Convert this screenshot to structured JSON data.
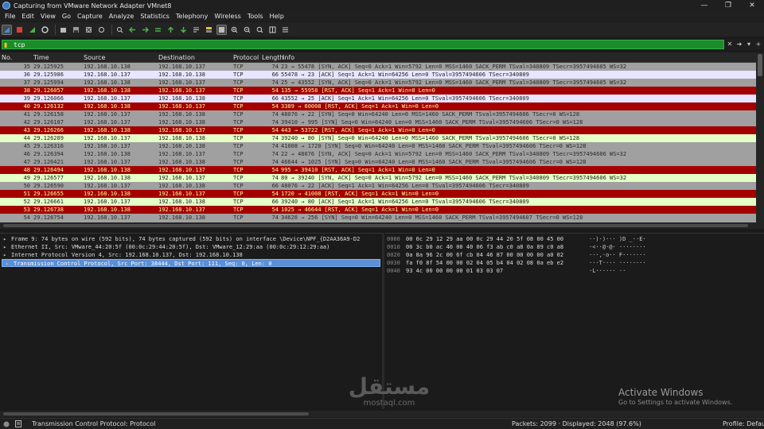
{
  "window": {
    "title": "Capturing from VMware Network Adapter VMnet8",
    "controls": [
      "—",
      "❐",
      "✕"
    ]
  },
  "menu": [
    "File",
    "Edit",
    "View",
    "Go",
    "Capture",
    "Analyze",
    "Statistics",
    "Telephony",
    "Wireless",
    "Tools",
    "Help"
  ],
  "filter": {
    "value": "tcp"
  },
  "columns": [
    "No.",
    "Time",
    "Source",
    "Destination",
    "Protocol",
    "Length",
    "Info"
  ],
  "packets": [
    {
      "no": "35",
      "time": "29.125925",
      "src": "192.168.10.138",
      "dst": "192.168.10.137",
      "proto": "TCP",
      "len": "74",
      "info": "23 → 55478 [SYN, ACK] Seq=0 Ack=1 Win=5792 Len=0 MSS=1460 SACK_PERM TSval=340809 TSecr=3957494605 WS=32",
      "bg": "#a0a0a0",
      "fg": "#2a2a2a"
    },
    {
      "no": "36",
      "time": "29.125986",
      "src": "192.168.10.137",
      "dst": "192.168.10.138",
      "proto": "TCP",
      "len": "66",
      "info": "55478 → 23 [ACK] Seq=1 Ack=1 Win=64256 Len=0 TSval=3957494606 TSecr=340809",
      "bg": "#e7e6ff",
      "fg": "#222222"
    },
    {
      "no": "37",
      "time": "29.125994",
      "src": "192.168.10.138",
      "dst": "192.168.10.137",
      "proto": "TCP",
      "len": "74",
      "info": "25 → 43552 [SYN, ACK] Seq=0 Ack=1 Win=5792 Len=0 MSS=1460 SACK_PERM TSval=340809 TSecr=3957494605 WS=32",
      "bg": "#a0a0a0",
      "fg": "#2a2a2a"
    },
    {
      "no": "38",
      "time": "29.126057",
      "src": "192.168.10.138",
      "dst": "192.168.10.137",
      "proto": "TCP",
      "len": "54",
      "info": "135 → 55958 [RST, ACK] Seq=1 Ack=1 Win=0 Len=0",
      "bg": "#a40000",
      "fg": "#fffc9c"
    },
    {
      "no": "39",
      "time": "29.126066",
      "src": "192.168.10.137",
      "dst": "192.168.10.138",
      "proto": "TCP",
      "len": "66",
      "info": "43552 → 25 [ACK] Seq=1 Ack=1 Win=64256 Len=0 TSval=3957494606 TSecr=340809",
      "bg": "#e7e6ff",
      "fg": "#222222"
    },
    {
      "no": "40",
      "time": "29.126132",
      "src": "192.168.10.138",
      "dst": "192.168.10.137",
      "proto": "TCP",
      "len": "54",
      "info": "3389 → 60008 [RST, ACK] Seq=1 Ack=1 Win=0 Len=0",
      "bg": "#a40000",
      "fg": "#fffc9c"
    },
    {
      "no": "41",
      "time": "29.126158",
      "src": "192.168.10.137",
      "dst": "192.168.10.138",
      "proto": "TCP",
      "len": "74",
      "info": "48076 → 22 [SYN] Seq=0 Win=64240 Len=0 MSS=1460 SACK_PERM TSval=3957494606 TSecr=0 WS=128",
      "bg": "#a0a0a0",
      "fg": "#2a2a2a"
    },
    {
      "no": "42",
      "time": "29.126187",
      "src": "192.168.10.137",
      "dst": "192.168.10.138",
      "proto": "TCP",
      "len": "74",
      "info": "39410 → 995 [SYN] Seq=0 Win=64240 Len=0 MSS=1460 SACK_PERM TSval=3957494606 TSecr=0 WS=128",
      "bg": "#a0a0a0",
      "fg": "#2a2a2a"
    },
    {
      "no": "43",
      "time": "29.126266",
      "src": "192.168.10.138",
      "dst": "192.168.10.137",
      "proto": "TCP",
      "len": "54",
      "info": "443 → 53722 [RST, ACK] Seq=1 Ack=1 Win=0 Len=0",
      "bg": "#a40000",
      "fg": "#fffc9c"
    },
    {
      "no": "44",
      "time": "29.126289",
      "src": "192.168.10.137",
      "dst": "192.168.10.138",
      "proto": "TCP",
      "len": "74",
      "info": "39240 → 80 [SYN] Seq=0 Win=64240 Len=0 MSS=1460 SACK_PERM TSval=3957494606 TSecr=0 WS=128",
      "bg": "#e4ffc7",
      "fg": "#222222"
    },
    {
      "no": "45",
      "time": "29.126316",
      "src": "192.168.10.137",
      "dst": "192.168.10.138",
      "proto": "TCP",
      "len": "74",
      "info": "41008 → 1720 [SYN] Seq=0 Win=64240 Len=0 MSS=1460 SACK_PERM TSval=3957494606 TSecr=0 WS=128",
      "bg": "#a0a0a0",
      "fg": "#2a2a2a"
    },
    {
      "no": "46",
      "time": "29.126394",
      "src": "192.168.10.138",
      "dst": "192.168.10.137",
      "proto": "TCP",
      "len": "74",
      "info": "22 → 48076 [SYN, ACK] Seq=0 Ack=1 Win=5792 Len=0 MSS=1460 SACK_PERM TSval=340809 TSecr=3957494606 WS=32",
      "bg": "#a0a0a0",
      "fg": "#2a2a2a"
    },
    {
      "no": "47",
      "time": "29.126421",
      "src": "192.168.10.137",
      "dst": "192.168.10.138",
      "proto": "TCP",
      "len": "74",
      "info": "46644 → 1025 [SYN] Seq=0 Win=64240 Len=0 MSS=1460 SACK_PERM TSval=3957494606 TSecr=0 WS=128",
      "bg": "#a0a0a0",
      "fg": "#2a2a2a"
    },
    {
      "no": "48",
      "time": "29.126494",
      "src": "192.168.10.138",
      "dst": "192.168.10.137",
      "proto": "TCP",
      "len": "54",
      "info": "995 → 39410 [RST, ACK] Seq=1 Ack=1 Win=0 Len=0",
      "bg": "#a40000",
      "fg": "#fffc9c"
    },
    {
      "no": "49",
      "time": "29.126577",
      "src": "192.168.10.138",
      "dst": "192.168.10.137",
      "proto": "TCP",
      "len": "74",
      "info": "80 → 39240 [SYN, ACK] Seq=0 Ack=1 Win=5792 Len=0 MSS=1460 SACK_PERM TSval=340809 TSecr=3957494606 WS=32",
      "bg": "#e4ffc7",
      "fg": "#222222"
    },
    {
      "no": "50",
      "time": "29.126590",
      "src": "192.168.10.137",
      "dst": "192.168.10.138",
      "proto": "TCP",
      "len": "66",
      "info": "48076 → 22 [ACK] Seq=1 Ack=1 Win=64256 Len=0 TSval=3957494606 TSecr=340809",
      "bg": "#a0a0a0",
      "fg": "#2a2a2a"
    },
    {
      "no": "51",
      "time": "29.126655",
      "src": "192.168.10.138",
      "dst": "192.168.10.137",
      "proto": "TCP",
      "len": "54",
      "info": "1720 → 41008 [RST, ACK] Seq=1 Ack=1 Win=0 Len=0",
      "bg": "#a40000",
      "fg": "#fffc9c"
    },
    {
      "no": "52",
      "time": "29.126661",
      "src": "192.168.10.137",
      "dst": "192.168.10.138",
      "proto": "TCP",
      "len": "66",
      "info": "39240 → 80 [ACK] Seq=1 Ack=1 Win=64256 Len=0 TSval=3957494606 TSecr=340809",
      "bg": "#e4ffc7",
      "fg": "#222222"
    },
    {
      "no": "53",
      "time": "29.126738",
      "src": "192.168.10.138",
      "dst": "192.168.10.137",
      "proto": "TCP",
      "len": "54",
      "info": "1025 → 46644 [RST, ACK] Seq=1 Ack=1 Win=0 Len=0",
      "bg": "#a40000",
      "fg": "#fffc9c"
    },
    {
      "no": "54",
      "time": "29.126754",
      "src": "192.168.10.137",
      "dst": "192.168.10.138",
      "proto": "TCP",
      "len": "74",
      "info": "34626 → 256 [SYN] Seq=0 Win=64240 Len=0 MSS=1460 SACK_PERM TSval=3957494607 TSecr=0 WS=128",
      "bg": "#a0a0a0",
      "fg": "#2a2a2a"
    },
    {
      "no": "55",
      "time": "29.126781",
      "src": "192.168.10.137",
      "dst": "192.168.10.138",
      "proto": "TCP",
      "len": "74",
      "info": "53840 → 554 [SYN] Seq=0 Win=64240 Len=0 MSS=1460 SACK_PERM TSval=3957494607 TSecr=0 WS=128",
      "bg": "#a0a0a0",
      "fg": "#2a2a2a"
    }
  ],
  "details": [
    {
      "text": "Frame 9: 74 bytes on wire (592 bits), 74 bytes captured (592 bits) on interface \\Device\\NPF_{D2AA36A9-D2",
      "selected": false
    },
    {
      "text": "Ethernet II, Src: VMware_44:20:5f (00:0c:29:44:20:5f), Dst: VMware_12:29:aa (00:0c:29:12:29:aa)",
      "selected": false
    },
    {
      "text": "Internet Protocol Version 4, Src: 192.168.10.137, Dst: 192.168.10.138",
      "selected": false
    },
    {
      "text": "Transmission Control Protocol, Src Port: 38444, Dst Port: 111, Seq: 0, Len: 0",
      "selected": true
    }
  ],
  "hex": [
    {
      "off": "0000",
      "bytes": "00 0c 29 12 29 aa 00 0c  29 44 20 5f 08 00 45 00",
      "ascii": "··)·)··· )D _··E·"
    },
    {
      "off": "0010",
      "bytes": "00 3c b0 ac 40 00 40 06  f3 ab c0 a8 0a 89 c0 a8",
      "ascii": "·<··@·@· ········"
    },
    {
      "off": "0020",
      "bytes": "0a 8a 96 2c 00 6f cb 04  46 87 00 00 00 00 a0 02",
      "ascii": "···,·o·· F·······"
    },
    {
      "off": "0030",
      "bytes": "fa f0 8f 54 00 00 02 04  05 b4 04 02 08 0a eb e2",
      "ascii": "···T···· ········"
    },
    {
      "off": "0040",
      "bytes": "93 4c 00 00 00 00 01 03  03 07",
      "ascii": "·L······ ··"
    }
  ],
  "watermark": {
    "arabic": "مستقل",
    "latin": "mostaql.com"
  },
  "activate": {
    "line1": "Activate Windows",
    "line2": "Go to Settings to activate Windows."
  },
  "status": {
    "field": "Transmission Control Protocol: Protocol",
    "packets": "Packets: 2099 · Displayed: 2048 (97.6%)",
    "profile": "Profile: Default"
  },
  "colors": {
    "accent": "#1c8c2a",
    "selection": "#5b8fd6"
  }
}
